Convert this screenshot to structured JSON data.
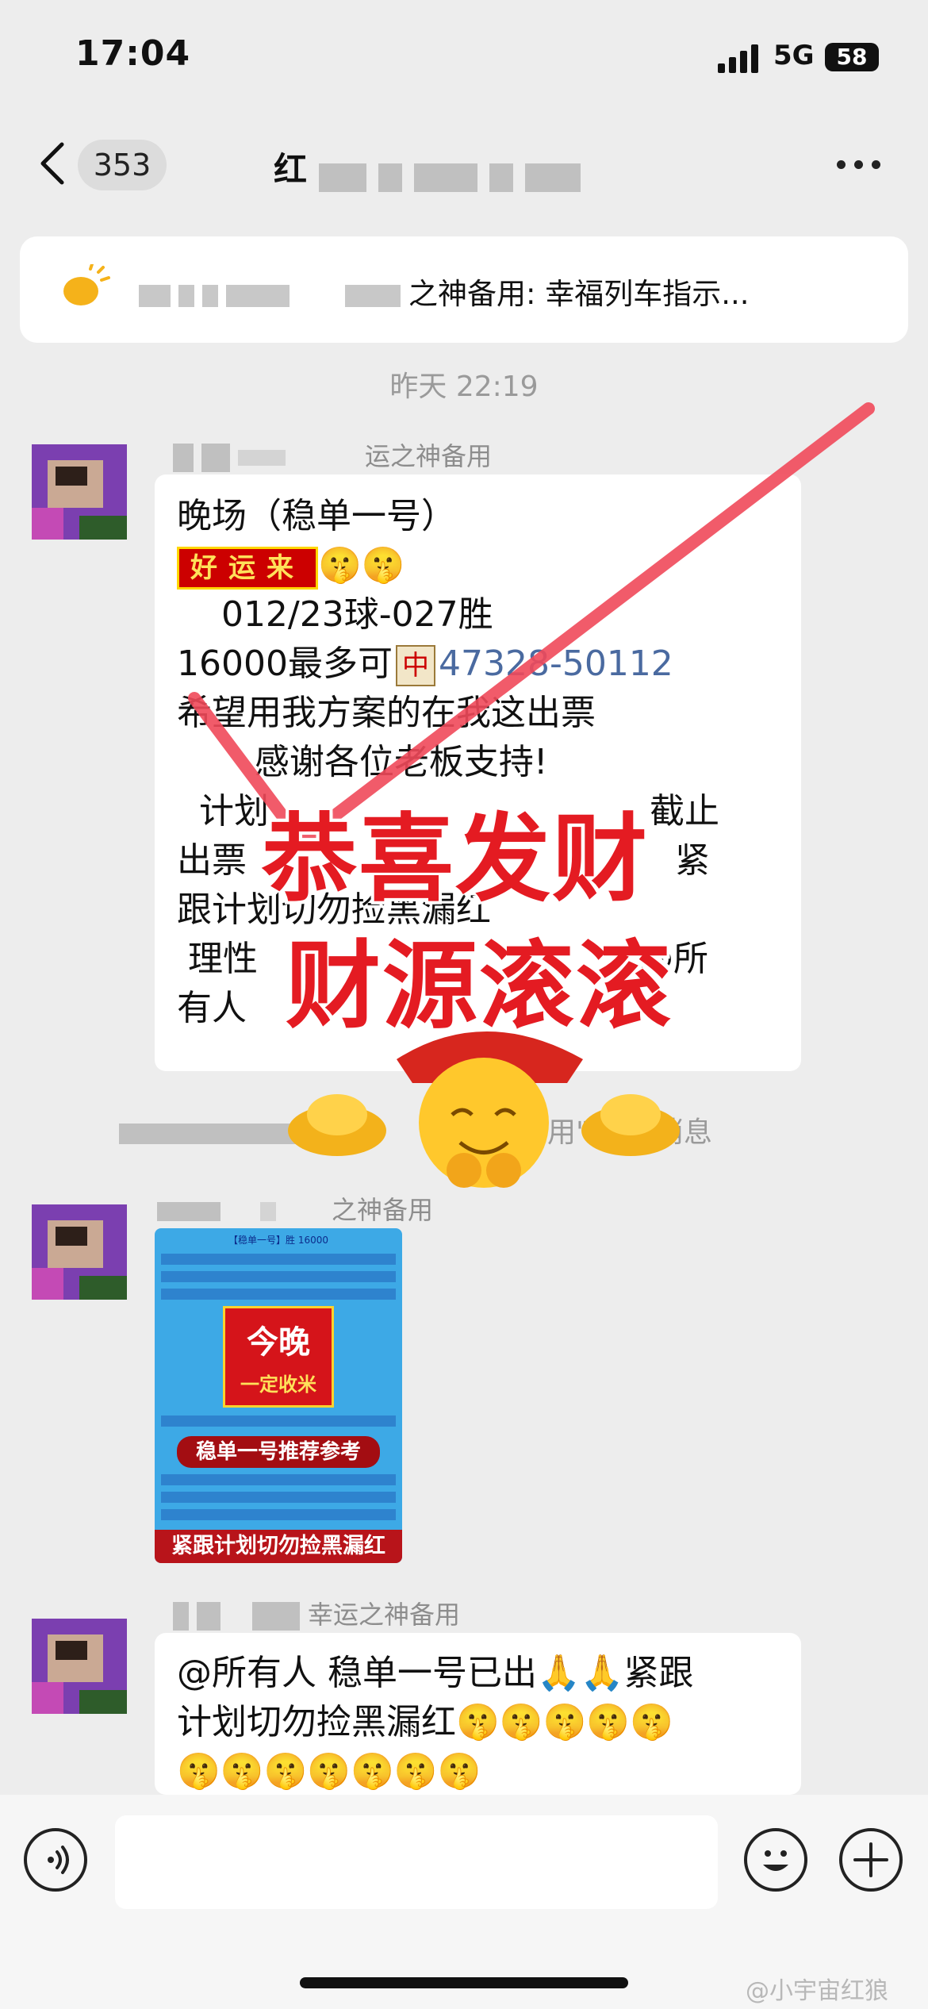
{
  "status_bar": {
    "time": "17:04",
    "network": "5G",
    "battery": "58"
  },
  "nav": {
    "back_count": "353",
    "title": "红"
  },
  "notice": {
    "text": "之神备用:    幸福列车指示..."
  },
  "timestamp": "昨天 22:19",
  "messages": [
    {
      "sender": "运之神备用",
      "lines": [
        "晚场（稳单一号）",
        "",
        "    012/23球-027胜",
        "16000最多可",
        "希望用我方案的在我这出票",
        "       感谢各位老板支持!",
        "  计划",
        "出票",
        "跟计划切勿捡黑漏红",
        " 理性",
        "有人"
      ],
      "lucky_tag": "好运来",
      "mahjong": "中",
      "link": "47328-50112",
      "tail_1": "截止",
      "tail_2": "紧",
      "tail_3": "@所"
    }
  ],
  "system_message": "用\"        一条消息",
  "image_message": {
    "sender": "之神备用",
    "title": "【稳单一号】胜 16000",
    "badge_line1": "今晚",
    "badge_line2": "一定收米",
    "subtitle": "稳单一号推荐参考",
    "footer": "紧跟计划切勿捡黑漏红"
  },
  "last_message": {
    "sender": "幸运之神备用",
    "line1": "@所有人 稳单一号已出🙏🙏紧跟",
    "line2": "计划切勿捡黑漏红🤫🤫🤫🤫🤫",
    "line3": "🤫🤫🤫🤫🤫🤫🤫"
  },
  "overlay": {
    "line1": "恭喜发财",
    "line2": "财源滚滚"
  },
  "input": {
    "placeholder": ""
  },
  "watermark": "@小宇宙红狼",
  "colors": {
    "background": "#ededed",
    "bubble": "#ffffff",
    "link": "#4a6aa0",
    "stamp_red": "#e41b22"
  }
}
